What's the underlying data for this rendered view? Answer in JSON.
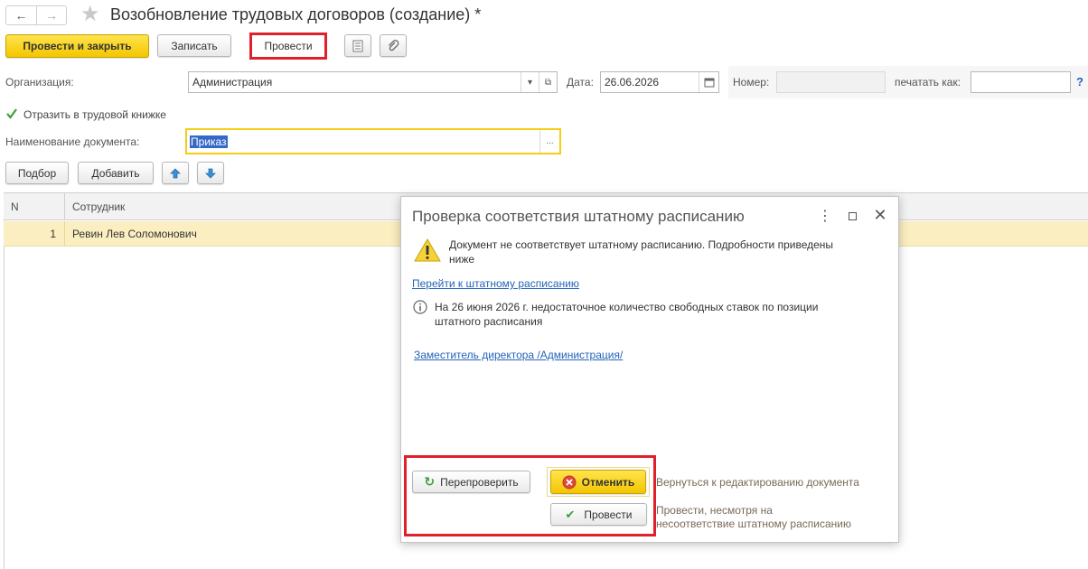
{
  "window": {
    "title": "Возобновление трудовых договоров (создание) *"
  },
  "toolbar": {
    "post_close_label": "Провести и закрыть",
    "save_label": "Записать",
    "post_label": "Провести"
  },
  "form": {
    "organization_label": "Организация:",
    "organization_value": "Администрация",
    "date_label": "Дата:",
    "date_value": "26.06.2026",
    "number_label": "Номер:",
    "number_value": "",
    "print_as_label": "печатать как:",
    "print_as_value": "",
    "help_label": "?",
    "labor_book_label": "Отразить в трудовой книжке",
    "labor_book_checked": true,
    "doc_name_label": "Наименование документа:",
    "doc_name_value": "Приказ",
    "select_label": "...",
    "pick_label": "Подбор",
    "add_label": "Добавить"
  },
  "table": {
    "columns": [
      "N",
      "Сотрудник"
    ],
    "rows": [
      {
        "n": "1",
        "employee": "Ревин Лев Соломонович"
      }
    ]
  },
  "dialog": {
    "title": "Проверка соответствия штатному расписанию",
    "warning_text_line1": "Документ не соответствует штатному расписанию. Подробности приведены",
    "warning_text_line2": "ниже",
    "goto_link": "Перейти к штатному расписанию",
    "info_text_line1": "На 26 июня 2026 г. недостаточное количество свободных ставок по позиции",
    "info_text_line2": "штатного расписания",
    "position_link": "Заместитель директора /Администрация/",
    "recheck_label": "Перепроверить",
    "cancel_label": "Отменить",
    "cancel_hint": "Вернуться к редактированию документа",
    "post_label": "Провести",
    "post_hint_line1": "Провести, несмотря на",
    "post_hint_line2": "несоответствие штатному расписанию"
  },
  "colors": {
    "accent_yellow": "#f5cd14",
    "highlight_red": "#e0202a",
    "link_blue": "#2463b8",
    "row_selected": "#fbeec0"
  }
}
